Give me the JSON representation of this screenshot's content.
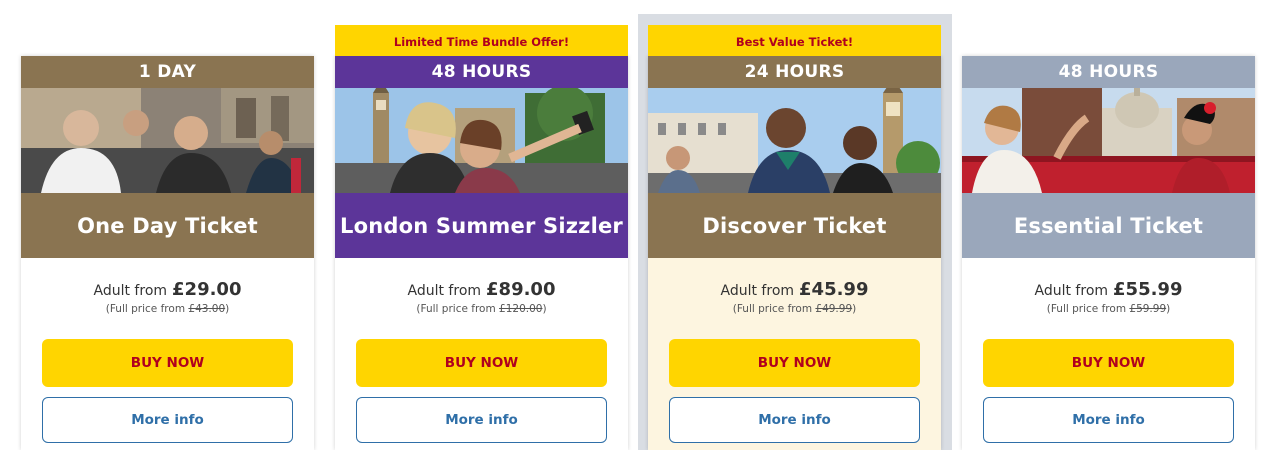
{
  "colors": {
    "gold": "#8a7451",
    "purple": "#5c3599",
    "slate": "#9aa7bb",
    "yellow": "#ffd500",
    "red_text": "#b0001e",
    "link_blue": "#2f6fa8",
    "cream": "#fdf5e0"
  },
  "cards": [
    {
      "banner": "",
      "duration": "1 DAY",
      "name": "One Day Ticket",
      "adult_prefix": "Adult from",
      "price": "£29.00",
      "full_price_prefix": "(Full price from ",
      "full_price": "£43.00",
      "full_price_suffix": ")",
      "buy_label": "BUY NOW",
      "info_label": "More info",
      "theme": "gold",
      "photo_icon": "tourists-on-bus-photo"
    },
    {
      "banner": "Limited Time Bundle Offer!",
      "duration": "48 HOURS",
      "name": "London Summer Sizzler",
      "adult_prefix": "Adult from",
      "price": "£89.00",
      "full_price_prefix": "(Full price from ",
      "full_price": "£120.00",
      "full_price_suffix": ")",
      "buy_label": "BUY NOW",
      "info_label": "More info",
      "theme": "purple",
      "photo_icon": "selfie-big-ben-photo"
    },
    {
      "banner": "Best Value Ticket!",
      "duration": "24 HOURS",
      "name": "Discover Ticket",
      "adult_prefix": "Adult from",
      "price": "£45.99",
      "full_price_prefix": "(Full price from ",
      "full_price": "£49.99",
      "full_price_suffix": ")",
      "buy_label": "BUY NOW",
      "info_label": "More info",
      "theme": "gold",
      "photo_icon": "women-westminster-photo"
    },
    {
      "banner": "",
      "duration": "48 HOURS",
      "name": "Essential Ticket",
      "adult_prefix": "Adult from",
      "price": "£55.99",
      "full_price_prefix": "(Full price from ",
      "full_price": "£59.99",
      "full_price_suffix": ")",
      "buy_label": "BUY NOW",
      "info_label": "More info",
      "theme": "slate",
      "photo_icon": "st-pauls-bus-photo"
    }
  ]
}
